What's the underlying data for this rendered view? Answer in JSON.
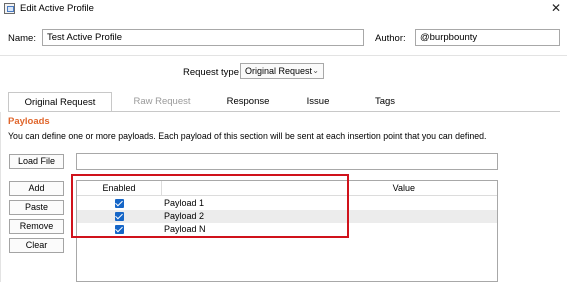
{
  "window": {
    "title": "Edit Active Profile",
    "close_glyph": "✕"
  },
  "fields": {
    "name_label": "Name:",
    "name_value": "Test Active Profile",
    "author_label": "Author:",
    "author_value": "@burpbounty"
  },
  "request_type": {
    "label": "Request type",
    "selected": "Original Request",
    "chevron": "⌄"
  },
  "tabs": [
    {
      "label": "Original Request",
      "state": "active"
    },
    {
      "label": "Raw Request",
      "state": "disabled"
    },
    {
      "label": "Response",
      "state": "normal"
    },
    {
      "label": "Issue",
      "state": "normal"
    },
    {
      "label": "Tags",
      "state": "normal"
    }
  ],
  "payloads_section": {
    "title": "Payloads",
    "description": "You can define one or more payloads. Each payload of this section will be sent at each insertion point that you can defined.",
    "title_color": "#e0662c"
  },
  "buttons": {
    "load_file": "Load File",
    "add": "Add",
    "paste": "Paste",
    "remove": "Remove",
    "clear": "Clear"
  },
  "table": {
    "columns": [
      "Enabled",
      "Value"
    ],
    "rows": [
      {
        "enabled": true,
        "value": "Payload 1"
      },
      {
        "enabled": true,
        "value": "Payload 2"
      },
      {
        "enabled": true,
        "value": "Payload N"
      }
    ]
  },
  "colors": {
    "checkbox": "#1666c7",
    "highlight_border": "#d0121b"
  }
}
